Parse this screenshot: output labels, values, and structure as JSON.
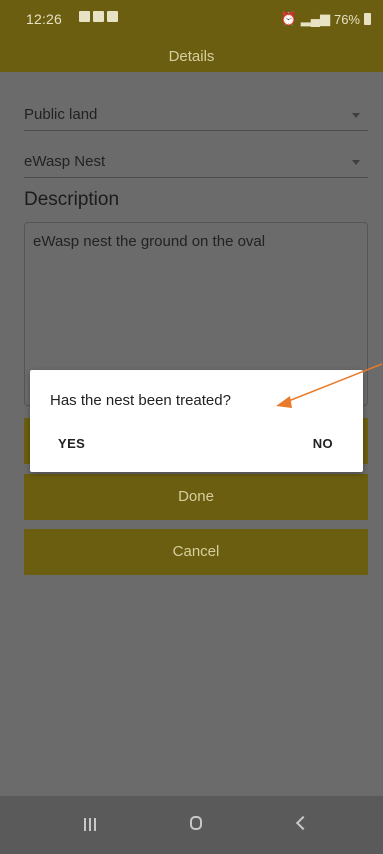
{
  "status_bar": {
    "time": "12:26",
    "right_text": "76%"
  },
  "app_bar": {
    "title": "Details"
  },
  "form": {
    "land_type": {
      "value": "Public land"
    },
    "nest_type": {
      "value": "eWasp Nest"
    },
    "description_label": "Description",
    "description_value": "eWasp nest the ground on the oval"
  },
  "buttons": {
    "done": "Done",
    "cancel": "Cancel"
  },
  "dialog": {
    "message": "Has the nest been treated?",
    "yes": "YES",
    "no": "NO"
  },
  "colors": {
    "accent_dimmed": "#6b5e10",
    "annotation_arrow": "#e87b2b",
    "dialog_bg": "#ffffff",
    "scrim": "#6b6b6b"
  },
  "icons": {
    "status_left": [
      "gallery-icon",
      "notification-icon",
      "notification-icon"
    ],
    "status_right": [
      "alarm-icon",
      "mute-icon",
      "wifi-icon",
      "signal-icon",
      "battery-icon"
    ],
    "nav": [
      "recents-icon",
      "home-icon",
      "back-icon"
    ]
  }
}
